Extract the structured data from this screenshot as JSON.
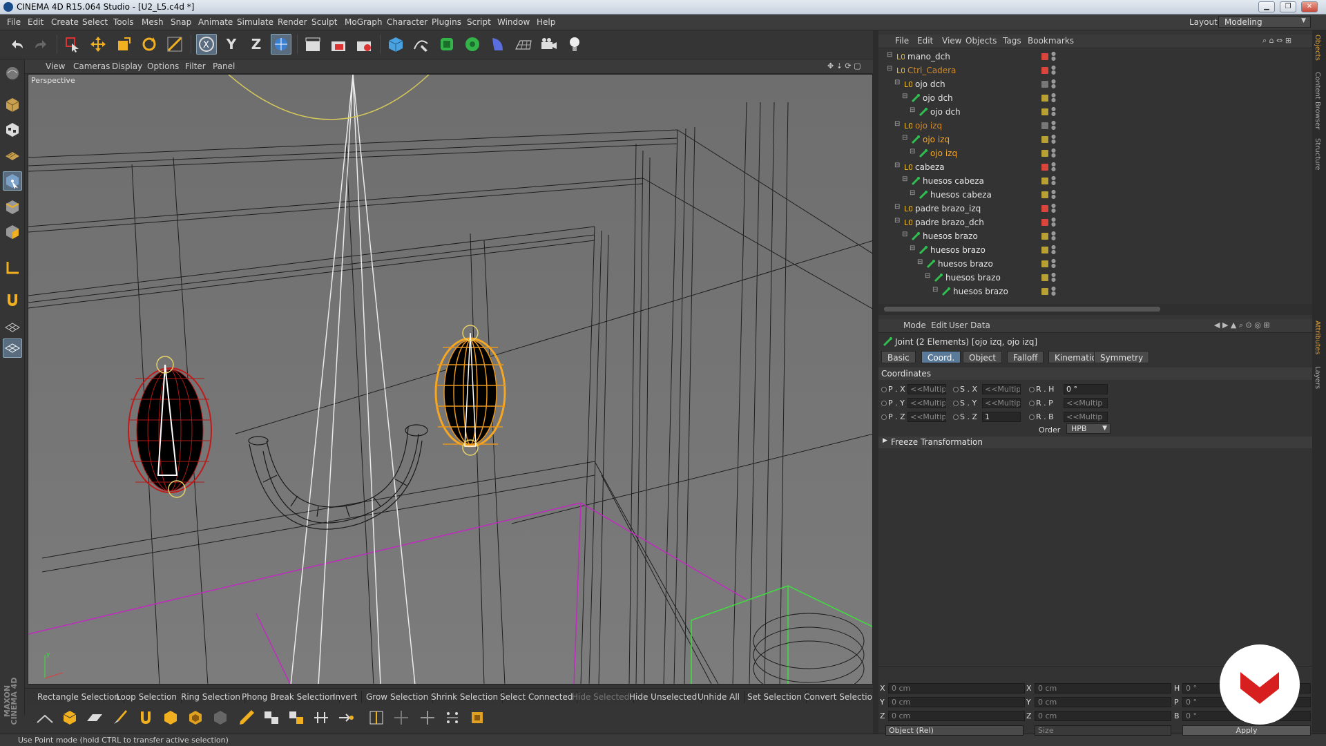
{
  "window": {
    "title": "CINEMA 4D R15.064 Studio - [U2_L5.c4d *]",
    "min": "▁",
    "max": "❐",
    "close": "✕"
  },
  "menu": [
    "File",
    "Edit",
    "Create",
    "Select",
    "Tools",
    "Mesh",
    "Snap",
    "Animate",
    "Simulate",
    "Render",
    "Sculpt",
    "MoGraph",
    "Character",
    "Plugins",
    "Script",
    "Window",
    "Help"
  ],
  "layout": {
    "label": "Layout:",
    "value": "Modeling"
  },
  "toolbar": {
    "x_label": "X",
    "y_label": "Y",
    "z_label": "Z"
  },
  "viewport": {
    "menu": [
      "View",
      "Cameras",
      "Display",
      "Options",
      "Filter",
      "Panel"
    ],
    "camera_label": "Perspective"
  },
  "selection_bar": [
    {
      "label": "Rectangle Selection",
      "enabled": true
    },
    {
      "label": "Loop Selection",
      "enabled": true
    },
    {
      "label": "Ring Selection",
      "enabled": true
    },
    {
      "label": "Phong Break Selection",
      "enabled": true
    },
    {
      "label": "Invert",
      "enabled": true
    },
    {
      "label": "Grow Selection",
      "enabled": true
    },
    {
      "label": "Shrink Selection",
      "enabled": true
    },
    {
      "label": "Select Connected",
      "enabled": true
    },
    {
      "label": "Hide Selected",
      "enabled": false
    },
    {
      "label": "Hide Unselected",
      "enabled": true
    },
    {
      "label": "Unhide All",
      "enabled": true
    },
    {
      "label": "Set Selection",
      "enabled": true
    },
    {
      "label": "Convert Selection",
      "enabled": true
    }
  ],
  "status": "Use Point mode (hold CTRL to transfer active selection)",
  "maxon": "MAXON CINEMA 4D",
  "object_manager": {
    "menu": [
      "File",
      "Edit",
      "View",
      "Objects",
      "Tags",
      "Bookmarks"
    ],
    "rows": [
      {
        "name": "mano_dch",
        "indent": 0,
        "type": "null",
        "state": "normal",
        "color": "#d9473c"
      },
      {
        "name": "Ctrl_Cadera",
        "indent": 0,
        "type": "null",
        "state": "orange",
        "color": "#d9473c"
      },
      {
        "name": "ojo dch",
        "indent": 1,
        "type": "null",
        "state": "normal",
        "color": "#777"
      },
      {
        "name": "ojo dch",
        "indent": 2,
        "type": "joint",
        "state": "normal",
        "color": "#b8a034"
      },
      {
        "name": "ojo dch",
        "indent": 3,
        "type": "joint",
        "state": "normal",
        "color": "#b8a034"
      },
      {
        "name": "ojo izq",
        "indent": 1,
        "type": "null",
        "state": "orange",
        "color": "#777"
      },
      {
        "name": "ojo izq",
        "indent": 2,
        "type": "joint",
        "state": "selected",
        "color": "#b8a034"
      },
      {
        "name": "ojo izq",
        "indent": 3,
        "type": "joint",
        "state": "selected",
        "color": "#b8a034"
      },
      {
        "name": "cabeza",
        "indent": 1,
        "type": "null",
        "state": "normal",
        "color": "#d9473c"
      },
      {
        "name": "huesos cabeza",
        "indent": 2,
        "type": "joint",
        "state": "normal",
        "color": "#b8a034"
      },
      {
        "name": "huesos cabeza",
        "indent": 3,
        "type": "joint",
        "state": "normal",
        "color": "#b8a034"
      },
      {
        "name": "padre brazo_izq",
        "indent": 1,
        "type": "null",
        "state": "normal",
        "color": "#d9473c"
      },
      {
        "name": "padre brazo_dch",
        "indent": 1,
        "type": "null",
        "state": "normal",
        "color": "#d9473c"
      },
      {
        "name": "huesos brazo",
        "indent": 2,
        "type": "joint",
        "state": "normal",
        "color": "#b8a034"
      },
      {
        "name": "huesos brazo",
        "indent": 3,
        "type": "joint",
        "state": "normal",
        "color": "#b8a034"
      },
      {
        "name": "huesos brazo",
        "indent": 4,
        "type": "joint",
        "state": "normal",
        "color": "#b8a034"
      },
      {
        "name": "huesos brazo",
        "indent": 5,
        "type": "joint",
        "state": "normal",
        "color": "#b8a034"
      },
      {
        "name": "huesos brazo",
        "indent": 6,
        "type": "joint",
        "state": "normal",
        "color": "#b8a034"
      }
    ]
  },
  "attributes": {
    "menu": [
      "Mode",
      "Edit",
      "User Data"
    ],
    "title": "Joint (2 Elements) [ojo izq, ojo izq]",
    "tabs": [
      {
        "label": "Basic",
        "active": false
      },
      {
        "label": "Coord.",
        "active": true
      },
      {
        "label": "Object",
        "active": false
      },
      {
        "label": "Falloff",
        "active": false
      },
      {
        "label": "Kinematics",
        "active": false
      },
      {
        "label": "Symmetry",
        "active": false
      }
    ],
    "section": "Coordinates",
    "fields": {
      "px": {
        "label": "P . X",
        "value": "<<Multip"
      },
      "py": {
        "label": "P . Y",
        "value": "<<Multip"
      },
      "pz": {
        "label": "P . Z",
        "value": "<<Multip"
      },
      "sx": {
        "label": "S . X",
        "value": "<<Multip"
      },
      "sy": {
        "label": "S . Y",
        "value": "<<Multip"
      },
      "sz": {
        "label": "S . Z",
        "value": "1"
      },
      "rh": {
        "label": "R . H",
        "value": "0 °"
      },
      "rp": {
        "label": "R . P",
        "value": "<<Multip"
      },
      "rb": {
        "label": "R . B",
        "value": "<<Multip"
      }
    },
    "order_label": "Order",
    "order_value": "HPB",
    "freeze": "Freeze Transformation"
  },
  "coord_manager": {
    "x": "0 cm",
    "y": "0 cm",
    "z": "0 cm",
    "x2": "0 cm",
    "y2": "0 cm",
    "z2": "0 cm",
    "h": "0 °",
    "p": "0 °",
    "b": "0 °",
    "mode": "Object (Rel)",
    "size": "Size",
    "apply": "Apply",
    "lx": "X",
    "ly": "Y",
    "lz": "Z",
    "lh": "H",
    "lp": "P",
    "lb": "B"
  },
  "side_tabs": [
    "Objects",
    "Content Browser",
    "Structure",
    "Attributes",
    "Layers"
  ],
  "colors": {
    "accent": "#5a7a9a",
    "selected_text": "#f5a623",
    "brand_red": "#d71f1f"
  }
}
